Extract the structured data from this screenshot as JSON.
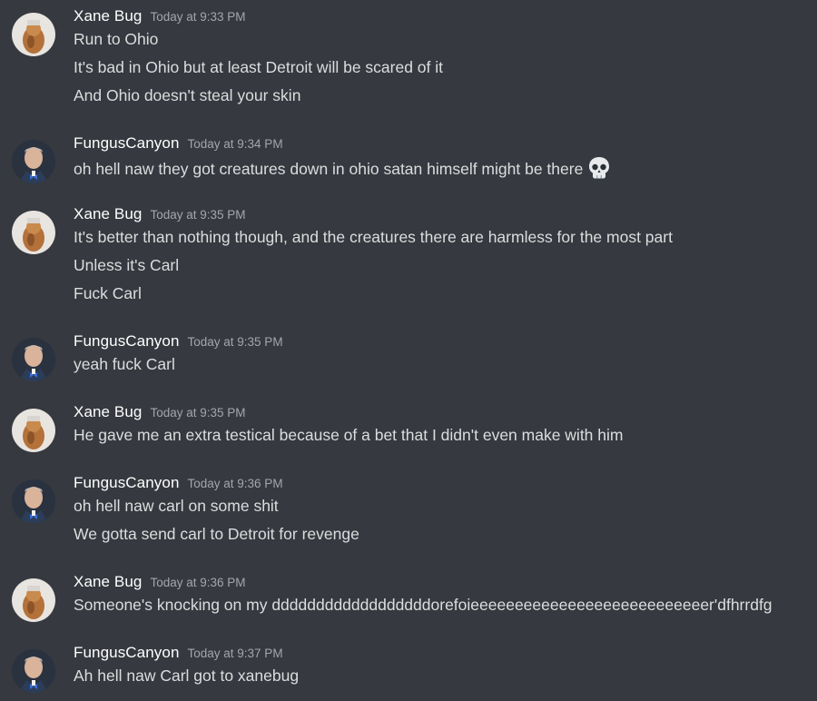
{
  "messages": [
    {
      "author": "Xane Bug",
      "avatar": "xane-bug-avatar",
      "timestamp": "Today at 9:33 PM",
      "lines": [
        "Run to Ohio",
        "It's bad in Ohio but at least Detroit will be scared of it",
        "And Ohio doesn't steal your skin"
      ]
    },
    {
      "author": "FungusCanyon",
      "avatar": "fungus-canyon-avatar",
      "timestamp": "Today at 9:34 PM",
      "lines": [
        "oh hell naw they got creatures down in ohio satan himself might be there"
      ],
      "emoji": "skull-emoji"
    },
    {
      "author": "Xane Bug",
      "avatar": "xane-bug-avatar",
      "timestamp": "Today at 9:35 PM",
      "lines": [
        "It's better than nothing though, and the creatures there are harmless for the most part",
        "Unless it's Carl",
        "Fuck Carl"
      ]
    },
    {
      "author": "FungusCanyon",
      "avatar": "fungus-canyon-avatar",
      "timestamp": "Today at 9:35 PM",
      "lines": [
        "yeah fuck Carl"
      ]
    },
    {
      "author": "Xane Bug",
      "avatar": "xane-bug-avatar",
      "timestamp": "Today at 9:35 PM",
      "lines": [
        "He gave me an extra testical because of a bet that I didn't even make with him"
      ]
    },
    {
      "author": "FungusCanyon",
      "avatar": "fungus-canyon-avatar",
      "timestamp": "Today at 9:36 PM",
      "lines": [
        "oh hell naw carl on some shit",
        "We gotta send carl to Detroit for revenge"
      ]
    },
    {
      "author": "Xane Bug",
      "avatar": "xane-bug-avatar",
      "timestamp": "Today at 9:36 PM",
      "lines": [
        "Someone's knocking on my ddddddddddddddddddorefoieeeeeeeeeeeeeeeeeeeeeeeeeeer'dfhrrdfg"
      ]
    },
    {
      "author": "FungusCanyon",
      "avatar": "fungus-canyon-avatar",
      "timestamp": "Today at 9:37 PM",
      "lines": [
        "Ah hell naw Carl got to xanebug"
      ]
    }
  ],
  "colors": {
    "background": "#36393f",
    "username": "#ffffff",
    "timestamp": "#a3a6aa",
    "text": "#dcddde"
  }
}
